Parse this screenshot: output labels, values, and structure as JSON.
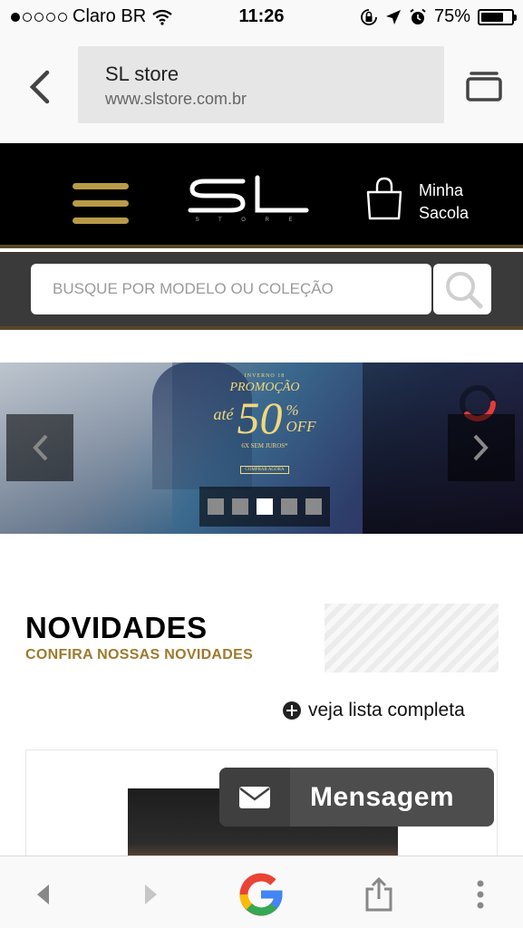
{
  "status_bar": {
    "carrier": "Claro BR",
    "time": "11:26",
    "battery": "75%",
    "battery_level": 0.75,
    "signal_bars": 1
  },
  "browser": {
    "page_title": "SL store",
    "url": "www.slstore.com.br"
  },
  "header": {
    "logo_text": "SL",
    "logo_subtext": "S T O R E",
    "bag_label_line1": "Minha",
    "bag_label_line2": "Sacola"
  },
  "search": {
    "placeholder": "BUSQUE POR MODELO OU COLEÇÃO"
  },
  "banner": {
    "season": "INVERNO 18",
    "promo_title": "PROMOÇÃO",
    "prefix": "até",
    "discount": "50",
    "percent": "%",
    "off": "OFF",
    "installments": "6X SEM JUROS*",
    "cta": "COMPRAR AGORA",
    "slide_count": 5,
    "active_slide": 3
  },
  "section": {
    "title": "NOVIDADES",
    "subtitle": "CONFIRA NOSSAS NOVIDADES",
    "see_all": "veja lista completa"
  },
  "message_button": {
    "label": "Mensagem"
  },
  "colors": {
    "gold": "#b99a49",
    "subtitle_gold": "#9e7a2e",
    "header_bg": "#000000",
    "search_band_bg": "#3a3a3a"
  },
  "icons": [
    "back-arrow-icon",
    "tabs-icon",
    "hamburger-menu-icon",
    "shopping-bag-icon",
    "search-icon",
    "chevron-left-icon",
    "chevron-right-icon",
    "loading-spinner-icon",
    "plus-circle-icon",
    "mail-icon",
    "google-icon",
    "share-icon",
    "more-vertical-icon",
    "wifi-icon",
    "lock-rotation-icon",
    "location-icon",
    "alarm-icon"
  ]
}
